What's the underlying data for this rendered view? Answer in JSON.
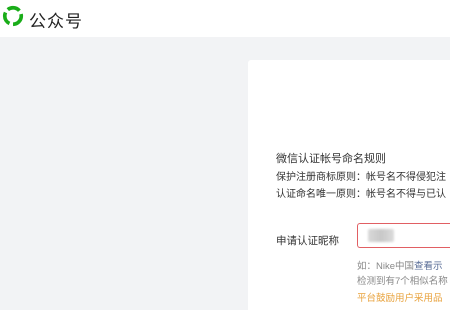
{
  "header": {
    "brand": "公众号"
  },
  "rules": {
    "title": "微信认证帐号命名规则",
    "lines": [
      "保护注册商标原则：帐号名不得侵犯注",
      "认证命名唯一原则：帐号名不得与已认"
    ]
  },
  "form": {
    "nickname_label": "申请认证昵称",
    "nickname_value": "",
    "hint_prefix": "如：Nike中国",
    "hint_link": "查看示",
    "similar_text": "检测到有7个相似名称",
    "encourage_text": "平台鼓励用户采用品"
  },
  "colors": {
    "brand_green": "#1aad19",
    "error_border": "#e15f63",
    "link": "#576b95",
    "warning": "#e8a23c"
  }
}
